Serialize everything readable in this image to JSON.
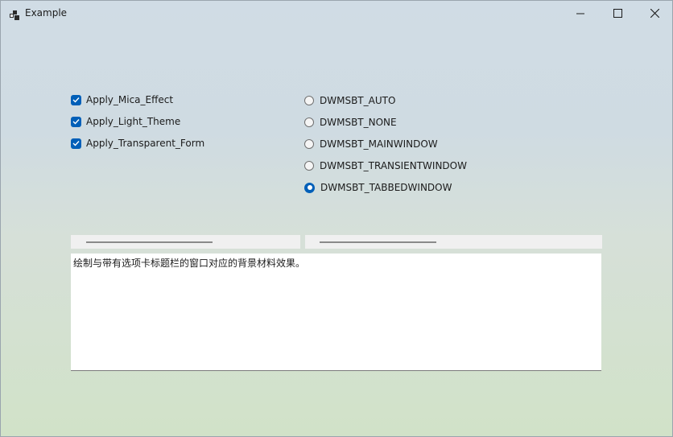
{
  "window": {
    "title": "Example"
  },
  "checkboxes": [
    {
      "label": "Apply_Mica_Effect",
      "checked": true
    },
    {
      "label": "Apply_Light_Theme",
      "checked": true
    },
    {
      "label": "Apply_Transparent_Form",
      "checked": true
    }
  ],
  "radios": [
    {
      "label": "DWMSBT_AUTO",
      "selected": false
    },
    {
      "label": "DWMSBT_NONE",
      "selected": false
    },
    {
      "label": "DWMSBT_MAINWINDOW",
      "selected": false
    },
    {
      "label": "DWMSBT_TRANSIENTWINDOW",
      "selected": false
    },
    {
      "label": "DWMSBT_TABBEDWINDOW",
      "selected": true
    }
  ],
  "textbox": {
    "text": "绘制与带有选项卡标题栏的窗口对应的背景材料效果。"
  },
  "colors": {
    "accent": "#005fb8"
  },
  "icons": {
    "app": "app-icon",
    "minimize": "minimize-icon",
    "maximize": "maximize-icon",
    "close": "close-icon",
    "check": "checkmark-icon"
  }
}
